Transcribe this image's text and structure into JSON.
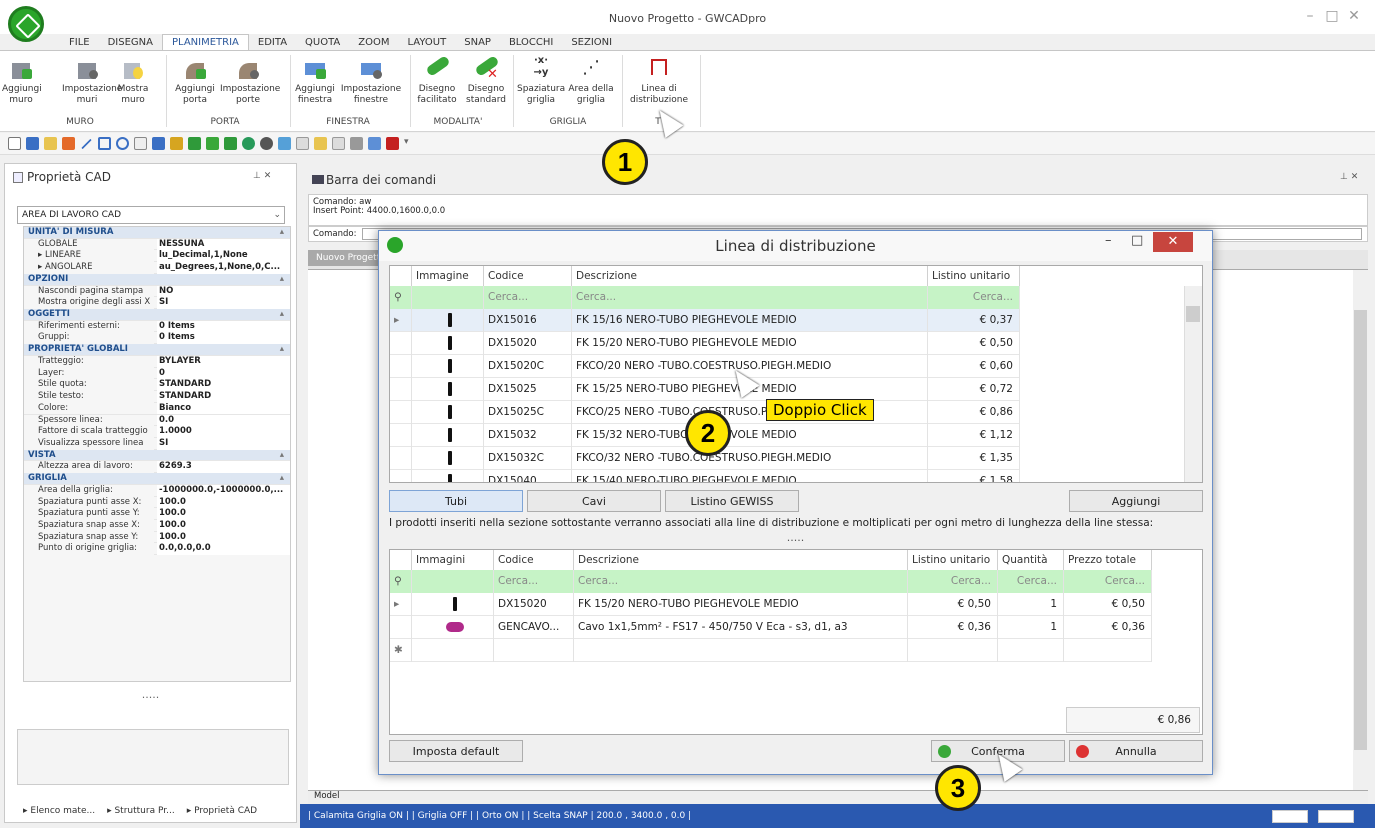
{
  "app": {
    "window_title": "Nuovo Progetto - GWCADpro"
  },
  "menu_tabs": [
    "FILE",
    "DISEGNA",
    "PLANIMETRIA",
    "EDITA",
    "QUOTA",
    "ZOOM",
    "LAYOUT",
    "SNAP",
    "BLOCCHI",
    "SEZIONI"
  ],
  "ribbon": {
    "buttons": [
      {
        "l1": "Aggiungi",
        "l2": "muro",
        "icon": "add-wall-icon"
      },
      {
        "l1": "Impostazione",
        "l2": "muri",
        "icon": "wall-settings-icon"
      },
      {
        "l1": "Mostra",
        "l2": "muro",
        "icon": "show-wall-icon"
      },
      {
        "l1": "Aggiungi",
        "l2": "porta",
        "icon": "add-door-icon"
      },
      {
        "l1": "Impostazione",
        "l2": "porte",
        "icon": "door-settings-icon"
      },
      {
        "l1": "Aggiungi",
        "l2": "finestra",
        "icon": "add-window-icon"
      },
      {
        "l1": "Impostazione",
        "l2": "finestre",
        "icon": "window-settings-icon"
      },
      {
        "l1": "Disegno",
        "l2": "facilitato",
        "icon": "easy-draw-icon"
      },
      {
        "l1": "Disegno",
        "l2": "standard",
        "icon": "standard-draw-icon"
      },
      {
        "l1": "Spaziatura",
        "l2": "griglia",
        "icon": "grid-spacing-icon"
      },
      {
        "l1": "Area della",
        "l2": "griglia",
        "icon": "grid-area-icon"
      },
      {
        "l1": "Linea di",
        "l2": "distribuzione",
        "icon": "distribution-line-icon"
      }
    ],
    "groups": [
      "MURO",
      "PORTA",
      "FINESTRA",
      "MODALITA'",
      "GRIGLIA",
      "T"
    ]
  },
  "left_panel": {
    "title": "Proprietà CAD",
    "selector": "AREA DI LAVORO CAD",
    "rows": [
      {
        "cat": "UNITA' DI MISURA"
      },
      {
        "k": "GLOBALE",
        "v": "NESSUNA"
      },
      {
        "k": "▸ LINEARE",
        "v": "lu_Decimal,1,None"
      },
      {
        "k": "▸ ANGOLARE",
        "v": "au_Degrees,1,None,0,C..."
      },
      {
        "cat": "OPZIONI"
      },
      {
        "k": "Nascondi pagina stampa",
        "v": "NO"
      },
      {
        "k": "Mostra origine degli assi X",
        "v": "SI"
      },
      {
        "cat": "OGGETTI"
      },
      {
        "k": "Riferimenti esterni:",
        "v": "0 Items"
      },
      {
        "k": "Gruppi:",
        "v": "0 Items"
      },
      {
        "cat": "PROPRIETA' GLOBALI"
      },
      {
        "k": "Tratteggio:",
        "v": "BYLAYER"
      },
      {
        "k": "Layer:",
        "v": "0"
      },
      {
        "k": "Stile quota:",
        "v": "STANDARD"
      },
      {
        "k": "Stile testo:",
        "v": "STANDARD"
      },
      {
        "k": "Colore:",
        "v": "Bianco"
      },
      {
        "k": "Spessore linea:",
        "v": "0.0"
      },
      {
        "k": "Fattore di scala tratteggio",
        "v": "1.0000"
      },
      {
        "k": "Visualizza spessore linea",
        "v": "SI"
      },
      {
        "cat": "VISTA"
      },
      {
        "k": "Altezza area di lavoro:",
        "v": "6269.3"
      },
      {
        "cat": "GRIGLIA"
      },
      {
        "k": "Area della griglia:",
        "v": "-1000000.0,-1000000.0,..."
      },
      {
        "k": "Spaziatura punti asse X:",
        "v": "100.0"
      },
      {
        "k": "Spaziatura punti asse Y:",
        "v": "100.0"
      },
      {
        "k": "Spaziatura snap asse X:",
        "v": "100.0"
      },
      {
        "k": "Spaziatura snap asse Y:",
        "v": "100.0"
      },
      {
        "k": "Punto di origine griglia:",
        "v": "0.0,0.0,0.0"
      }
    ],
    "dots": ".....",
    "bottom_tabs": [
      "Elenco mate...",
      "Struttura Pr...",
      "Proprietà CAD"
    ]
  },
  "command": {
    "title": "Barra dei comandi",
    "line1": "Comando: aw",
    "line2": "Insert Point: 4400.0,1600.0,0.0",
    "prompt_label": "Comando:",
    "doc_tab": "Nuovo Progetto",
    "model_tab": "Model"
  },
  "status": "| Calamita Griglia ON | | Griglia OFF | | Orto ON | | Scelta SNAP | 200.0 , 3400.0 , 0.0 |",
  "dialog": {
    "title": "Linea di distribuzione",
    "top_headers": [
      "Immagine",
      "Codice",
      "Descrizione",
      "Listino unitario"
    ],
    "filter_text": "Cerca...",
    "top_rows": [
      {
        "code": "DX15016",
        "desc": "FK 15/16 NERO-TUBO PIEGHEVOLE MEDIO",
        "price": "€ 0,37"
      },
      {
        "code": "DX15020",
        "desc": "FK 15/20 NERO-TUBO PIEGHEVOLE MEDIO",
        "price": "€ 0,50"
      },
      {
        "code": "DX15020C",
        "desc": "FKCO/20 NERO -TUBO.COESTRUSO.PIEGH.MEDIO",
        "price": "€ 0,60"
      },
      {
        "code": "DX15025",
        "desc": "FK 15/25 NERO-TUBO PIEGHEVOLE MEDIO",
        "price": "€ 0,72"
      },
      {
        "code": "DX15025C",
        "desc": "FKCO/25 NERO -TUBO.COESTRUSO.PIEGH.MEDIO",
        "price": "€ 0,86"
      },
      {
        "code": "DX15032",
        "desc": "FK 15/32 NERO-TUBO PIEGHEVOLE MEDIO",
        "price": "€ 1,12"
      },
      {
        "code": "DX15032C",
        "desc": "FKCO/32 NERO -TUBO.COESTRUSO.PIEGH.MEDIO",
        "price": "€ 1,35"
      },
      {
        "code": "DX15040",
        "desc": "FK 15/40 NERO-TUBO PIEGHEVOLE MEDIO",
        "price": "€ 1,58"
      }
    ],
    "cat_buttons": [
      "Tubi",
      "Cavi",
      "Listino GEWISS"
    ],
    "add_button": "Aggiungi",
    "info": "I prodotti inseriti nella sezione sottostante verranno associati alla line di distribuzione e moltiplicati per ogni metro di lunghezza della line stessa:",
    "info_dots": ".....",
    "bottom_headers": [
      "Immagini",
      "Codice",
      "Descrizione",
      "Listino unitario",
      "Quantità",
      "Prezzo totale"
    ],
    "bottom_rows": [
      {
        "code": "DX15020",
        "desc": "FK 15/20 NERO-TUBO PIEGHEVOLE MEDIO",
        "price": "€ 0,50",
        "qty": "1",
        "total": "€ 0,50"
      },
      {
        "code": "GENCAVO...",
        "desc": "Cavo 1x1,5mm² - FS17 - 450/750 V Eca - s3, d1, a3",
        "price": "€ 0,36",
        "qty": "1",
        "total": "€ 0,36"
      }
    ],
    "grand_total": "€ 0,86",
    "default_button": "Imposta default",
    "confirm_button": "Conferma",
    "cancel_button": "Annulla"
  },
  "callouts": {
    "one": "1",
    "two": "2",
    "three": "3",
    "double_click": "Doppio Click"
  }
}
